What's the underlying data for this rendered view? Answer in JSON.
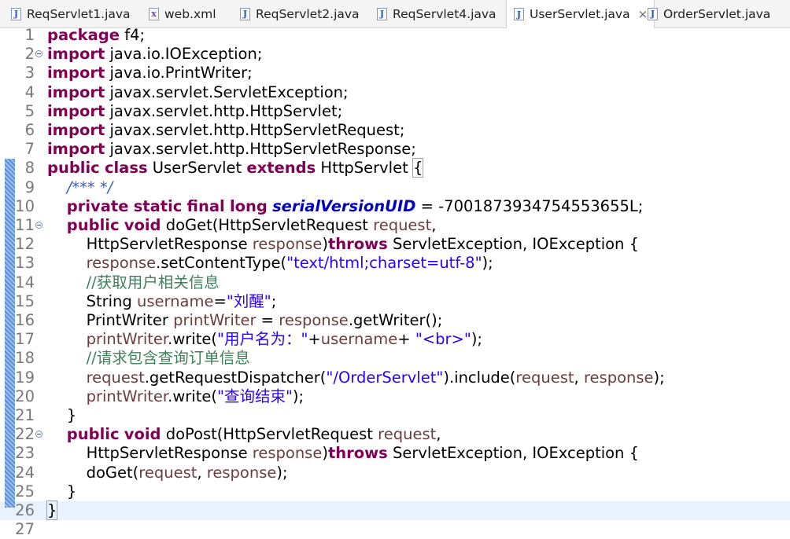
{
  "tabs": [
    {
      "label": "ReqServlet1.java",
      "icon": "java-file-icon",
      "icon_glyph": "J"
    },
    {
      "label": "web.xml",
      "icon": "xml-file-icon",
      "icon_glyph": "x"
    },
    {
      "label": "ReqServlet2.java",
      "icon": "java-file-icon",
      "icon_glyph": "J"
    },
    {
      "label": "ReqServlet4.java",
      "icon": "java-file-icon",
      "icon_glyph": "J"
    },
    {
      "label": "UserServlet.java",
      "icon": "java-file-icon",
      "icon_glyph": "J",
      "active": true,
      "close": "×"
    },
    {
      "label": "OrderServlet.java",
      "icon": "java-file-icon",
      "icon_glyph": "J"
    }
  ],
  "colors": {
    "keyword": "#7f0055",
    "string": "#2a00ff",
    "comment": "#3f7f5f",
    "field": "#0000c0",
    "javadoc": "#3f5fbf",
    "variable": "#6a3e3e"
  },
  "lines": [
    {
      "n": "1",
      "t": [
        [
          "kw",
          "package"
        ],
        [
          "txt",
          " f4;"
        ]
      ]
    },
    {
      "n": "2",
      "fold": true,
      "t": [
        [
          "kw",
          "import"
        ],
        [
          "txt",
          " java.io.IOException;"
        ]
      ]
    },
    {
      "n": "3",
      "t": [
        [
          "kw",
          "import"
        ],
        [
          "txt",
          " java.io.PrintWriter;"
        ]
      ]
    },
    {
      "n": "4",
      "t": [
        [
          "kw",
          "import"
        ],
        [
          "txt",
          " javax.servlet.ServletException;"
        ]
      ]
    },
    {
      "n": "5",
      "t": [
        [
          "kw",
          "import"
        ],
        [
          "txt",
          " javax.servlet.http.HttpServlet;"
        ]
      ]
    },
    {
      "n": "6",
      "t": [
        [
          "kw",
          "import"
        ],
        [
          "txt",
          " javax.servlet.http.HttpServletRequest;"
        ]
      ]
    },
    {
      "n": "7",
      "t": [
        [
          "kw",
          "import"
        ],
        [
          "txt",
          " javax.servlet.http.HttpServletResponse;"
        ]
      ]
    },
    {
      "n": "8",
      "t": [
        [
          "kw",
          "public"
        ],
        [
          "txt",
          " "
        ],
        [
          "kw",
          "class"
        ],
        [
          "txt",
          " UserServlet "
        ],
        [
          "kw",
          "extends"
        ],
        [
          "txt",
          " HttpServlet "
        ],
        [
          "bracket",
          "{"
        ]
      ]
    },
    {
      "n": "9",
      "t": [
        [
          "txt",
          "    "
        ],
        [
          "jd",
          "/*** */"
        ]
      ]
    },
    {
      "n": "10",
      "t": [
        [
          "txt",
          "    "
        ],
        [
          "kw",
          "private"
        ],
        [
          "txt",
          " "
        ],
        [
          "kw",
          "static"
        ],
        [
          "txt",
          " "
        ],
        [
          "kw",
          "final"
        ],
        [
          "txt",
          " "
        ],
        [
          "kw",
          "long"
        ],
        [
          "txt",
          " "
        ],
        [
          "fld",
          "serialVersionUID"
        ],
        [
          "txt",
          " = -7001873934754553655L;"
        ]
      ]
    },
    {
      "n": "11",
      "fold": true,
      "override": true,
      "t": [
        [
          "txt",
          "    "
        ],
        [
          "kw",
          "public"
        ],
        [
          "txt",
          " "
        ],
        [
          "kw",
          "void"
        ],
        [
          "txt",
          " doGet(HttpServletRequest "
        ],
        [
          "var",
          "request"
        ],
        [
          "txt",
          ","
        ]
      ]
    },
    {
      "n": "12",
      "t": [
        [
          "txt",
          "        HttpServletResponse "
        ],
        [
          "var",
          "response"
        ],
        [
          "txt",
          ")"
        ],
        [
          "kw",
          "throws"
        ],
        [
          "txt",
          " ServletException, IOException {"
        ]
      ]
    },
    {
      "n": "13",
      "t": [
        [
          "txt",
          "        "
        ],
        [
          "var",
          "response"
        ],
        [
          "txt",
          ".setContentType("
        ],
        [
          "str",
          "\"text/html;charset=utf-8\""
        ],
        [
          "txt",
          ");"
        ]
      ]
    },
    {
      "n": "14",
      "t": [
        [
          "txt",
          "        "
        ],
        [
          "cm",
          "//获取用户相关信息"
        ]
      ]
    },
    {
      "n": "15",
      "t": [
        [
          "txt",
          "        String "
        ],
        [
          "var",
          "username"
        ],
        [
          "txt",
          "="
        ],
        [
          "str",
          "\"刘醒\""
        ],
        [
          "txt",
          ";"
        ]
      ]
    },
    {
      "n": "16",
      "t": [
        [
          "txt",
          "        PrintWriter "
        ],
        [
          "var",
          "printWriter"
        ],
        [
          "txt",
          " = "
        ],
        [
          "var",
          "response"
        ],
        [
          "txt",
          ".getWriter();"
        ]
      ]
    },
    {
      "n": "17",
      "t": [
        [
          "txt",
          "        "
        ],
        [
          "var",
          "printWriter"
        ],
        [
          "txt",
          ".write("
        ],
        [
          "str",
          "\"用户名为：\""
        ],
        [
          "txt",
          "+"
        ],
        [
          "var",
          "username"
        ],
        [
          "txt",
          "+ "
        ],
        [
          "str",
          "\"<br>\""
        ],
        [
          "txt",
          ");"
        ]
      ]
    },
    {
      "n": "18",
      "t": [
        [
          "txt",
          "        "
        ],
        [
          "cm",
          "//请求包含查询订单信息"
        ]
      ]
    },
    {
      "n": "19",
      "t": [
        [
          "txt",
          "        "
        ],
        [
          "var",
          "request"
        ],
        [
          "txt",
          ".getRequestDispatcher("
        ],
        [
          "str",
          "\"/OrderServlet\""
        ],
        [
          "txt",
          ").include("
        ],
        [
          "var",
          "request"
        ],
        [
          "txt",
          ", "
        ],
        [
          "var",
          "response"
        ],
        [
          "txt",
          ");"
        ]
      ]
    },
    {
      "n": "20",
      "t": [
        [
          "txt",
          "        "
        ],
        [
          "var",
          "printWriter"
        ],
        [
          "txt",
          ".write("
        ],
        [
          "str",
          "\"查询结束\""
        ],
        [
          "txt",
          ");"
        ]
      ]
    },
    {
      "n": "21",
      "t": [
        [
          "txt",
          "    }"
        ]
      ]
    },
    {
      "n": "22",
      "fold": true,
      "override": true,
      "t": [
        [
          "txt",
          "    "
        ],
        [
          "kw",
          "public"
        ],
        [
          "txt",
          " "
        ],
        [
          "kw",
          "void"
        ],
        [
          "txt",
          " doPost(HttpServletRequest "
        ],
        [
          "var",
          "request"
        ],
        [
          "txt",
          ","
        ]
      ]
    },
    {
      "n": "23",
      "t": [
        [
          "txt",
          "        HttpServletResponse "
        ],
        [
          "var",
          "response"
        ],
        [
          "txt",
          ")"
        ],
        [
          "kw",
          "throws"
        ],
        [
          "txt",
          " ServletException, IOException {"
        ]
      ]
    },
    {
      "n": "24",
      "t": [
        [
          "txt",
          "        doGet("
        ],
        [
          "var",
          "request"
        ],
        [
          "txt",
          ", "
        ],
        [
          "var",
          "response"
        ],
        [
          "txt",
          ");"
        ]
      ]
    },
    {
      "n": "25",
      "t": [
        [
          "txt",
          "    }"
        ]
      ]
    },
    {
      "n": "26",
      "current": true,
      "t": [
        [
          "bracket",
          "}"
        ]
      ]
    },
    {
      "n": "27",
      "t": []
    }
  ]
}
